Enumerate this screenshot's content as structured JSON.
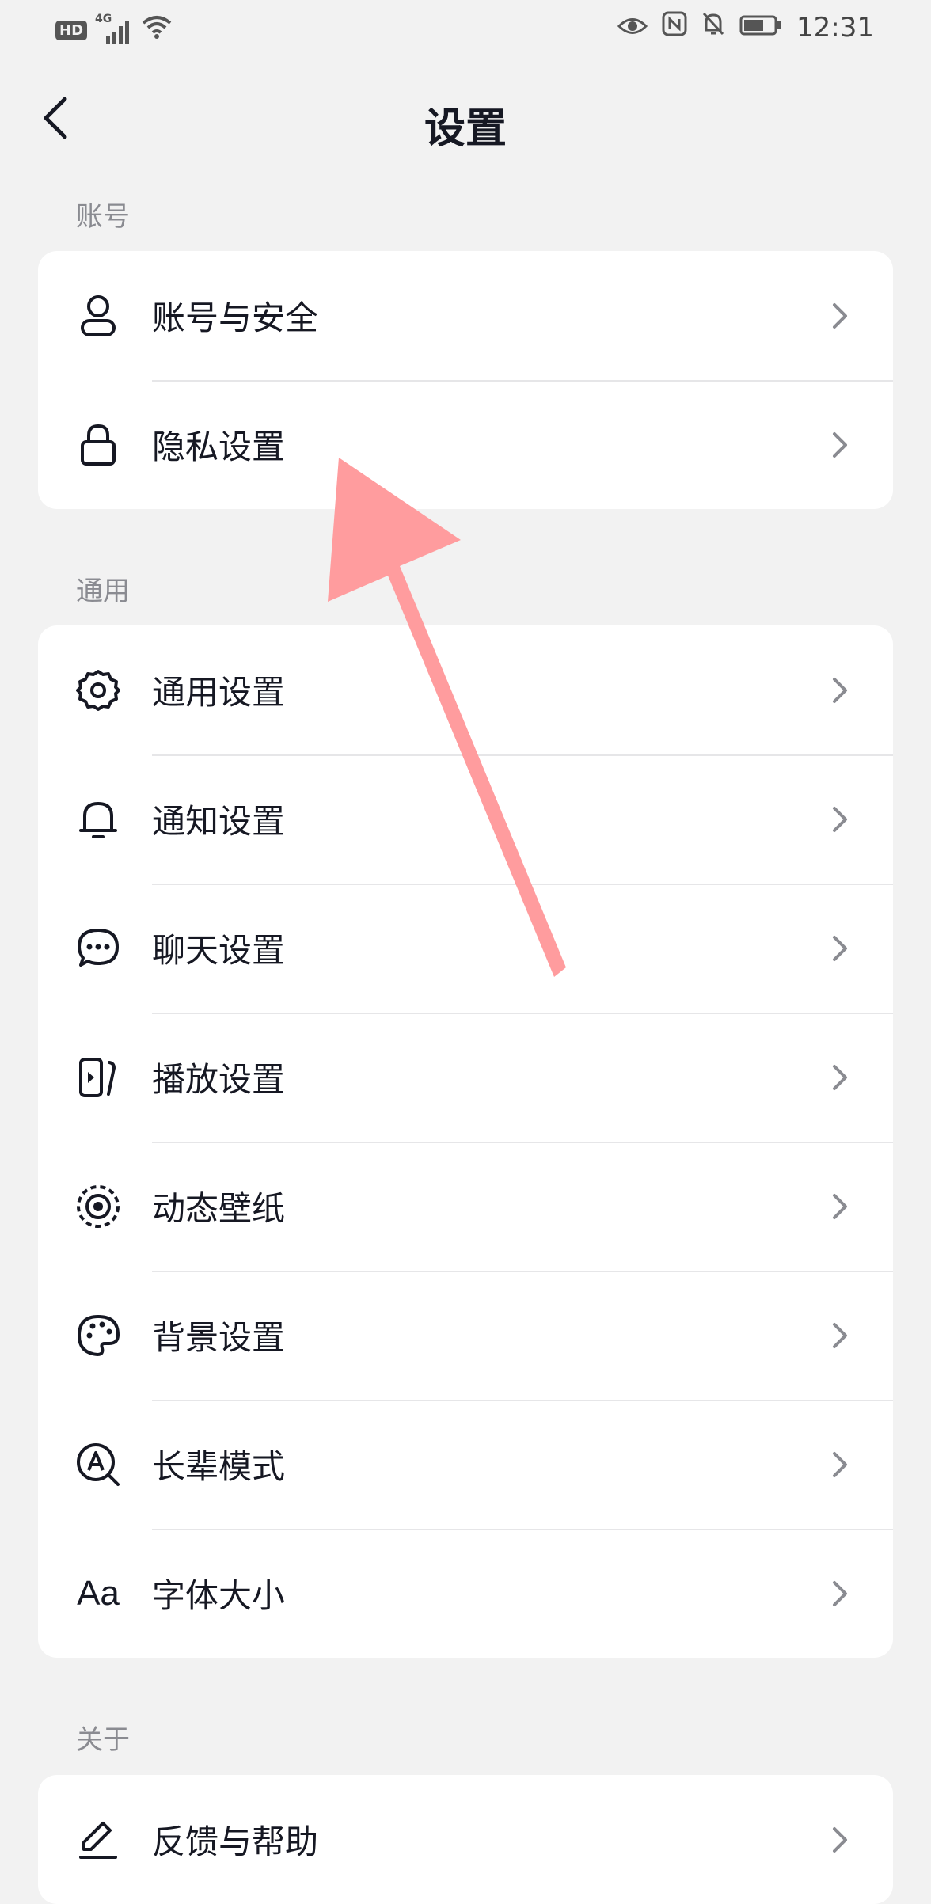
{
  "status_bar": {
    "hd_badge": "HD",
    "network": "4G",
    "time": "12:31"
  },
  "header": {
    "title": "设置",
    "back_icon": "chevron-left-icon"
  },
  "sections": [
    {
      "title": "账号",
      "items": [
        {
          "label": "账号与安全",
          "icon": "user-icon"
        },
        {
          "label": "隐私设置",
          "icon": "lock-icon"
        }
      ]
    },
    {
      "title": "通用",
      "items": [
        {
          "label": "通用设置",
          "icon": "gear-icon"
        },
        {
          "label": "通知设置",
          "icon": "bell-icon"
        },
        {
          "label": "聊天设置",
          "icon": "chat-bubble-icon"
        },
        {
          "label": "播放设置",
          "icon": "play-icon"
        },
        {
          "label": "动态壁纸",
          "icon": "live-wallpaper-icon"
        },
        {
          "label": "背景设置",
          "icon": "palette-icon"
        },
        {
          "label": "长辈模式",
          "icon": "elder-mode-icon"
        },
        {
          "label": "字体大小",
          "icon": "font-size-icon",
          "icon_text": "Aa"
        }
      ]
    },
    {
      "title": "关于",
      "items": [
        {
          "label": "反馈与帮助",
          "icon": "edit-icon"
        }
      ]
    }
  ],
  "colors": {
    "background": "#f2f2f2",
    "card": "#ffffff",
    "text_primary": "#161823",
    "text_secondary": "#8a8b91",
    "chevron": "#8a8b91",
    "annotation_arrow": "#ff9c9e"
  }
}
